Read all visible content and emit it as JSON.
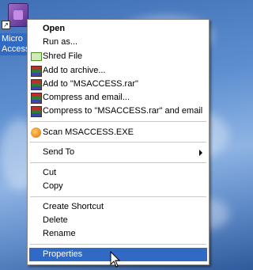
{
  "desktop_icon": {
    "label_line1": "Micro",
    "label_line2": "Access"
  },
  "menu": {
    "items": [
      {
        "label": "Open",
        "icon": ""
      },
      {
        "label": "Run as...",
        "icon": ""
      },
      {
        "label": "Shred File",
        "icon": "shredder-icon"
      },
      {
        "label": "Add to archive...",
        "icon": "winrar-icon"
      },
      {
        "label": "Add to \"MSACCESS.rar\"",
        "icon": "winrar-icon"
      },
      {
        "label": "Compress and email...",
        "icon": "winrar-icon"
      },
      {
        "label": "Compress to \"MSACCESS.rar\" and email",
        "icon": "winrar-icon"
      },
      {
        "label": "Scan MSACCESS.EXE",
        "icon": "antivirus-scan-icon"
      },
      {
        "label": "Send To",
        "icon": "submenu-arrow-icon"
      },
      {
        "label": "Cut",
        "icon": ""
      },
      {
        "label": "Copy",
        "icon": ""
      },
      {
        "label": "Create Shortcut",
        "icon": ""
      },
      {
        "label": "Delete",
        "icon": ""
      },
      {
        "label": "Rename",
        "icon": ""
      },
      {
        "label": "Properties",
        "icon": ""
      }
    ],
    "selected_item": "Properties"
  },
  "colors": {
    "selection": "#316ac5",
    "menu_background": "#ffffff",
    "separator": "#c8c8c8"
  }
}
